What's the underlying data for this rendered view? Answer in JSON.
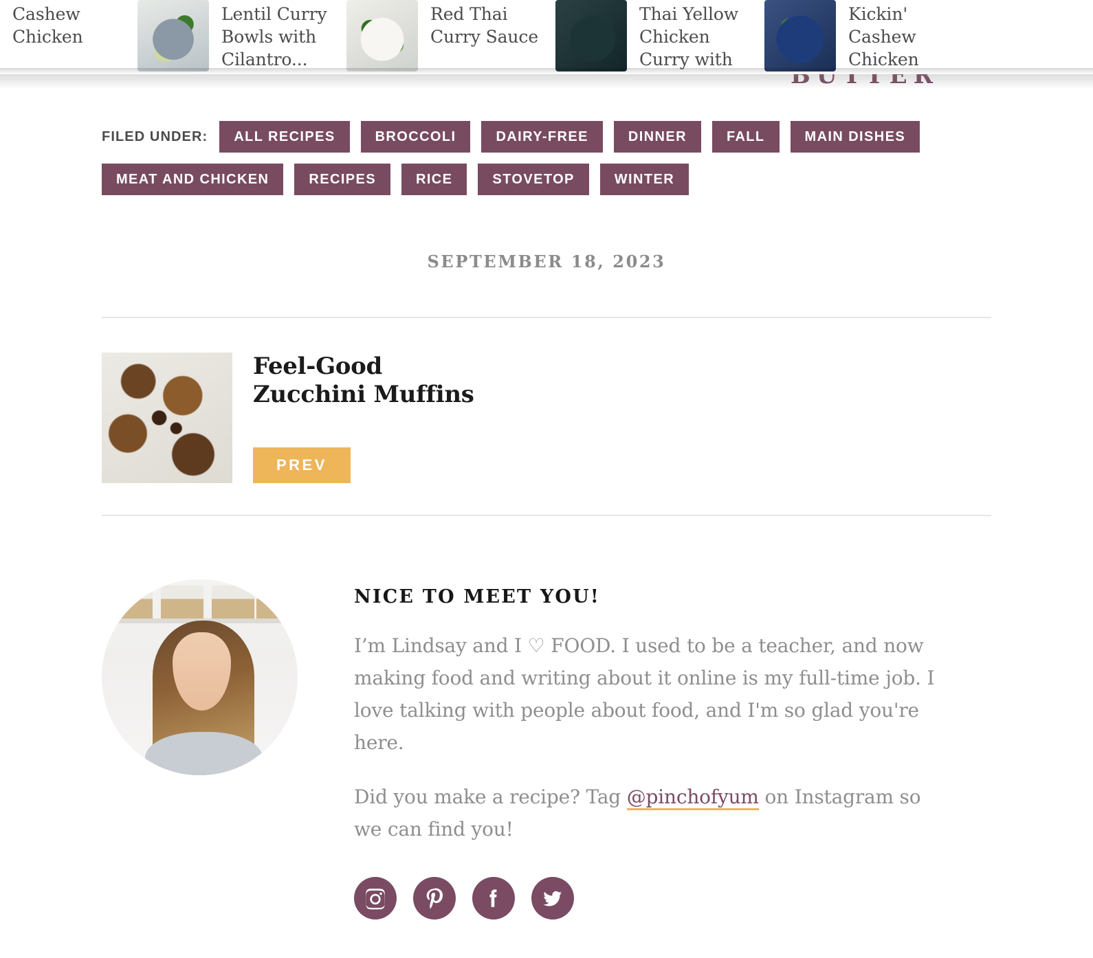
{
  "recipe_strip": {
    "cards": [
      {
        "title": "Cashew Chicken",
        "thumb_class": "food-a"
      },
      {
        "title": "Lentil Curry Bowls with Cilantro...",
        "thumb_class": "food-b"
      },
      {
        "title": "Red Thai Curry Sauce",
        "thumb_class": "food-c"
      },
      {
        "title": "Thai Yellow Chicken Curry with Potatoes",
        "thumb_class": "food-d"
      },
      {
        "title": "Kickin' Cashew Chicken",
        "thumb_class": "food-e"
      }
    ]
  },
  "background": {
    "logo_fragment": "BUTTER"
  },
  "filed_under": {
    "label": "FILED UNDER:",
    "tags": [
      "ALL RECIPES",
      "BROCCOLI",
      "DAIRY-FREE",
      "DINNER",
      "FALL",
      "MAIN DISHES",
      "MEAT AND CHICKEN",
      "RECIPES",
      "RICE",
      "STOVETOP",
      "WINTER"
    ]
  },
  "post": {
    "date": "SEPTEMBER 18, 2023"
  },
  "post_nav": {
    "prev_title": "Feel-Good Zucchini Muffins",
    "prev_button_label": "PREV"
  },
  "about": {
    "heading": "NICE TO MEET YOU!",
    "paragraph_1_before": "I’m Lindsay and I ♡ FOOD. I used to be a teacher, and now making food and writing about it online is my full-time job. I love talking with people about food, and I'm so glad you're here.",
    "paragraph_2_before": "Did you make a recipe? Tag ",
    "link_text": "@pinchofyum",
    "paragraph_2_after": " on Instagram so we can find you!",
    "social": [
      {
        "name": "instagram",
        "label": "Instagram"
      },
      {
        "name": "pinterest",
        "label": "Pinterest"
      },
      {
        "name": "facebook",
        "label": "Facebook"
      },
      {
        "name": "twitter",
        "label": "Twitter"
      }
    ]
  },
  "colors": {
    "plum": "#7a4b63",
    "tag_plum": "#784b61",
    "amber": "#eeb559",
    "body_gray": "#8e8e8e",
    "date_gray": "#8b8b8b",
    "divider": "#e6e6e6"
  }
}
